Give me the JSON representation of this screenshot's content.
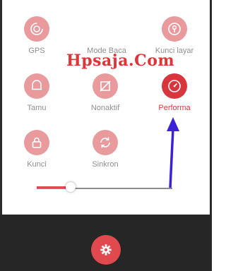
{
  "tiles": [
    {
      "label": "GPS",
      "icon": "gps-icon"
    },
    {
      "label": "Mode Baca",
      "icon": ""
    },
    {
      "label": "Kunci layar",
      "icon": "screen-lock-icon"
    },
    {
      "label": "Tamu",
      "icon": "guest-icon"
    },
    {
      "label": "Nonaktif",
      "icon": "slash-icon"
    },
    {
      "label": "Performa",
      "icon": "performance-icon",
      "active": true
    },
    {
      "label": "Kunci",
      "icon": "lock-icon"
    },
    {
      "label": "Sinkron",
      "icon": "sync-icon"
    }
  ],
  "watermark": "Hpsaja.Com",
  "brightness": {
    "level": 0.25
  },
  "settings": {
    "icon": "gear-icon"
  },
  "colors": {
    "accent": "#d9353c",
    "inactive": "#e89a9c",
    "arrow": "#3b22d6"
  }
}
